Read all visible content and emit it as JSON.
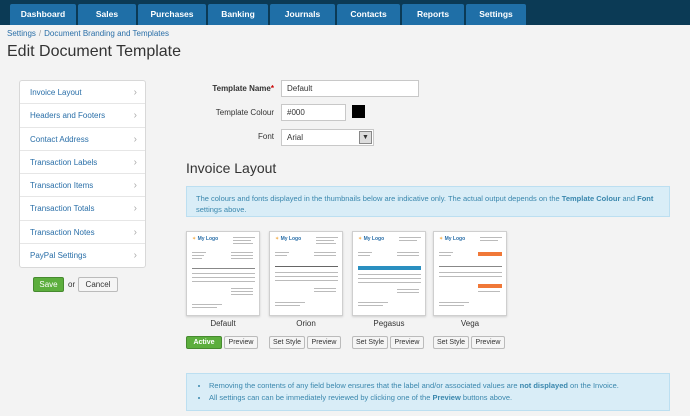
{
  "nav": {
    "tabs": [
      "Dashboard",
      "Sales",
      "Purchases",
      "Banking",
      "Journals",
      "Contacts",
      "Reports",
      "Settings"
    ]
  },
  "breadcrumb": {
    "items": [
      "Settings",
      "Document Branding and Templates"
    ]
  },
  "page": {
    "title": "Edit Document Template"
  },
  "side_menu": {
    "items": [
      "Invoice Layout",
      "Headers and Footers",
      "Contact Address",
      "Transaction Labels",
      "Transaction Items",
      "Transaction Totals",
      "Transaction Notes",
      "PayPal Settings"
    ]
  },
  "actions": {
    "save": "Save",
    "or": "or",
    "cancel": "Cancel"
  },
  "form": {
    "template_name_label": "Template Name",
    "template_name_value": "Default",
    "template_colour_label": "Template Colour",
    "template_colour_value": "#000",
    "font_label": "Font",
    "font_value": "Arial"
  },
  "layout_section": {
    "title": "Invoice Layout",
    "info_pre": "The colours and fonts displayed in the thumbnails below are indicative only. The actual output depends on the ",
    "info_b1": "Template Colour",
    "info_mid": " and ",
    "info_b2": "Font",
    "info_post": " settings above."
  },
  "templates": [
    {
      "name": "Default",
      "logo": "My Logo",
      "primary": "Active",
      "secondary": "Preview"
    },
    {
      "name": "Orion",
      "logo": "My Logo",
      "primary": "Set Style",
      "secondary": "Preview"
    },
    {
      "name": "Pegasus",
      "logo": "My Logo",
      "primary": "Set Style",
      "secondary": "Preview"
    },
    {
      "name": "Vega",
      "logo": "My Logo",
      "primary": "Set Style",
      "secondary": "Preview"
    }
  ],
  "notes": {
    "line1_pre": "Removing the contents of any field below ensures that the label and/or associated values are ",
    "line1_b": "not displayed",
    "line1_post": " on the Invoice.",
    "line2_pre": "All settings can can be immediately reviewed by clicking one of the ",
    "line2_b": "Preview",
    "line2_post": " buttons above."
  },
  "colors": {
    "nav_bg": "#0b3a55",
    "tab_bg": "#1f6fa7",
    "save_green": "#5cae3d",
    "info_bg": "#d9edf7",
    "swatch": "#000000",
    "pegasus_band": "#2a8fc0",
    "vega_band": "#f07838"
  }
}
